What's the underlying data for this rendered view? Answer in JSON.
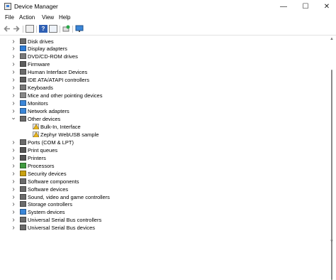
{
  "window": {
    "title": "Device Manager",
    "minimize_glyph": "—",
    "maximize_glyph": "☐",
    "close_glyph": "✕"
  },
  "menu": [
    "File",
    "Action",
    "View",
    "Help"
  ],
  "toolbar": [
    "back-arrow-icon",
    "forward-arrow-icon",
    "properties-icon",
    "help-icon",
    "show-hidden-icon",
    "scan-hardware-icon",
    "monitor-icon"
  ],
  "tree": [
    {
      "label": "Disk drives",
      "expanded": false,
      "depth": 0,
      "icon": "disk-icon",
      "color": "#6b6b6b"
    },
    {
      "label": "Display adapters",
      "expanded": false,
      "depth": 0,
      "icon": "display-adapter-icon",
      "color": "#2f7dd6"
    },
    {
      "label": "DVD/CD-ROM drives",
      "expanded": false,
      "depth": 0,
      "icon": "dvd-icon",
      "color": "#7a7a7a"
    },
    {
      "label": "Firmware",
      "expanded": false,
      "depth": 0,
      "icon": "firmware-icon",
      "color": "#5d5d5d"
    },
    {
      "label": "Human Interface Devices",
      "expanded": false,
      "depth": 0,
      "icon": "hid-icon",
      "color": "#6a6a6a"
    },
    {
      "label": "IDE ATA/ATAPI controllers",
      "expanded": false,
      "depth": 0,
      "icon": "ide-controller-icon",
      "color": "#5c5c5c"
    },
    {
      "label": "Keyboards",
      "expanded": false,
      "depth": 0,
      "icon": "keyboard-icon",
      "color": "#777777"
    },
    {
      "label": "Mice and other pointing devices",
      "expanded": false,
      "depth": 0,
      "icon": "mouse-icon",
      "color": "#888888"
    },
    {
      "label": "Monitors",
      "expanded": false,
      "depth": 0,
      "icon": "monitor-icon",
      "color": "#3a86d8"
    },
    {
      "label": "Network adapters",
      "expanded": false,
      "depth": 0,
      "icon": "network-icon",
      "color": "#3a86d8"
    },
    {
      "label": "Other devices",
      "expanded": true,
      "depth": 0,
      "icon": "unknown-device-icon",
      "color": "#6b6b6b"
    },
    {
      "label": "Bulk-In, Interface",
      "expanded": null,
      "depth": 1,
      "icon": "warning-device-icon",
      "color": "#c89a1a"
    },
    {
      "label": "Zephyr WebUSB sample",
      "expanded": null,
      "depth": 1,
      "icon": "warning-device-icon",
      "color": "#c89a1a"
    },
    {
      "label": "Ports (COM & LPT)",
      "expanded": false,
      "depth": 0,
      "icon": "port-icon",
      "color": "#6b6b6b"
    },
    {
      "label": "Print queues",
      "expanded": false,
      "depth": 0,
      "icon": "printer-icon",
      "color": "#555555"
    },
    {
      "label": "Printers",
      "expanded": false,
      "depth": 0,
      "icon": "printer-icon",
      "color": "#555555"
    },
    {
      "label": "Processors",
      "expanded": false,
      "depth": 0,
      "icon": "processor-icon",
      "color": "#3f9a3f"
    },
    {
      "label": "Security devices",
      "expanded": false,
      "depth": 0,
      "icon": "security-icon",
      "color": "#c8a010"
    },
    {
      "label": "Software components",
      "expanded": false,
      "depth": 0,
      "icon": "software-component-icon",
      "color": "#6b6b6b"
    },
    {
      "label": "Software devices",
      "expanded": false,
      "depth": 0,
      "icon": "software-device-icon",
      "color": "#6b6b6b"
    },
    {
      "label": "Sound, video and game controllers",
      "expanded": false,
      "depth": 0,
      "icon": "sound-icon",
      "color": "#6b6b6b"
    },
    {
      "label": "Storage controllers",
      "expanded": false,
      "depth": 0,
      "icon": "storage-icon",
      "color": "#6b6b6b"
    },
    {
      "label": "System devices",
      "expanded": false,
      "depth": 0,
      "icon": "system-device-icon",
      "color": "#3a86d8"
    },
    {
      "label": "Universal Serial Bus controllers",
      "expanded": false,
      "depth": 0,
      "icon": "usb-icon",
      "color": "#6b6b6b"
    },
    {
      "label": "Universal Serial Bus devices",
      "expanded": false,
      "depth": 0,
      "icon": "usb-icon",
      "color": "#6b6b6b"
    }
  ]
}
